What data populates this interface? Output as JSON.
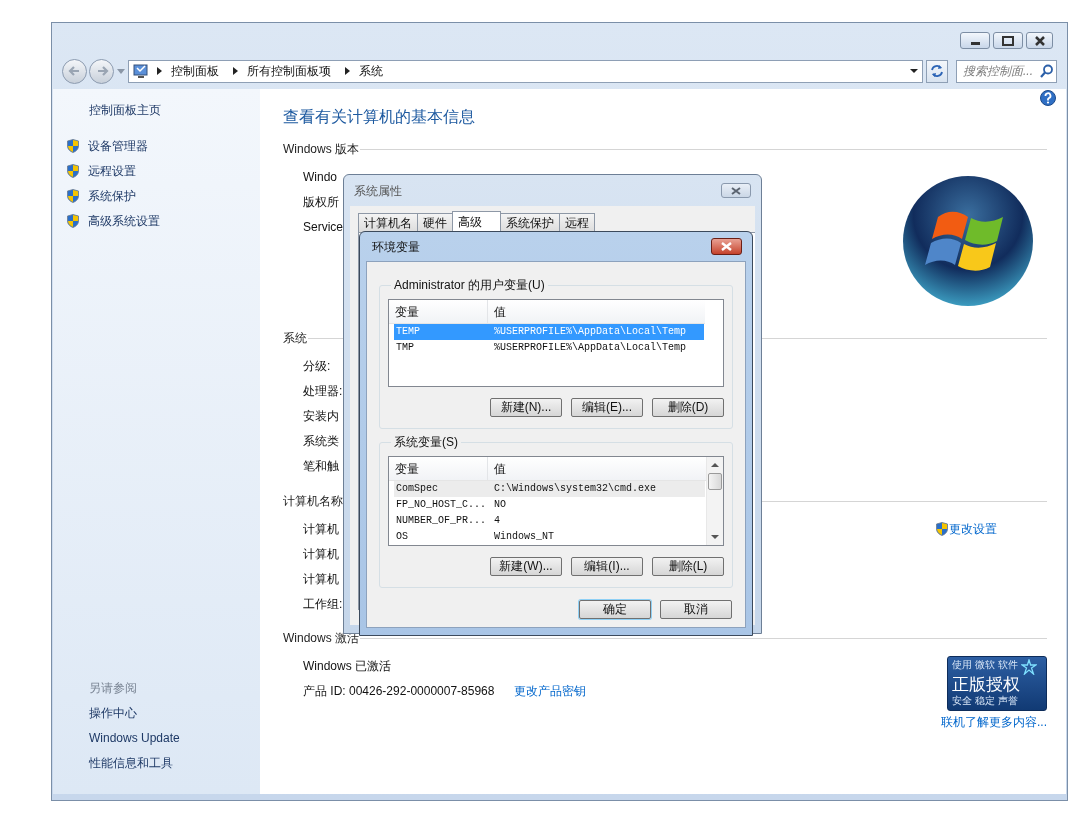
{
  "address_bar": {
    "crumbs": [
      "控制面板",
      "所有控制面板项",
      "系统"
    ],
    "search_placeholder": "搜索控制面..."
  },
  "sidebar": {
    "home": "控制面板主页",
    "tasks": [
      "设备管理器",
      "远程设置",
      "系统保护",
      "高级系统设置"
    ],
    "see_also_title": "另请参阅",
    "see_also": [
      "操作中心",
      "Windows Update",
      "性能信息和工具"
    ]
  },
  "main": {
    "title": "查看有关计算机的基本信息",
    "sections": [
      {
        "heading": "Windows 版本",
        "rows": [
          "Windo",
          "版权所",
          "Service"
        ]
      },
      {
        "heading": "系统",
        "rows": [
          "分级:",
          "处理器:",
          "安装内",
          "系统类",
          "笔和触"
        ]
      },
      {
        "heading": "计算机名称",
        "rows": [
          "计算机",
          "计算机",
          "计算机",
          "工作组:"
        ],
        "link": "更改设置"
      },
      {
        "heading": "Windows 激活",
        "rows": [
          "Windows 已激活",
          "产品 ID: 00426-292-0000007-85968"
        ],
        "link": "更改产品密钥"
      }
    ],
    "badge": {
      "top": "使用 微软 软件",
      "middle": "正版授权",
      "bottom": "安全 稳定 声誉"
    },
    "badge_link": "联机了解更多内容..."
  },
  "system_properties": {
    "title": "系统属性",
    "tabs": [
      {
        "label": "计算机名",
        "selected": false
      },
      {
        "label": "硬件",
        "selected": false
      },
      {
        "label": "高级",
        "selected": true
      },
      {
        "label": "系统保护",
        "selected": false
      },
      {
        "label": "远程",
        "selected": false
      }
    ]
  },
  "env_dialog": {
    "title": "环境变量",
    "groups": [
      {
        "title": "Administrator 的用户变量(U)",
        "focused": true,
        "columns": [
          "变量",
          "值"
        ],
        "rows": [
          {
            "name": "TEMP",
            "value": "%USERPROFILE%\\AppData\\Local\\Temp",
            "selected": true
          },
          {
            "name": "TMP",
            "value": "%USERPROFILE%\\AppData\\Local\\Temp",
            "selected": false
          }
        ],
        "buttons": [
          "新建(N)...",
          "编辑(E)...",
          "删除(D)"
        ]
      },
      {
        "title": "系统变量(S)",
        "focused": false,
        "columns": [
          "变量",
          "值"
        ],
        "rows": [
          {
            "name": "ComSpec",
            "value": "C:\\Windows\\system32\\cmd.exe",
            "selected": true
          },
          {
            "name": "FP_NO_HOST_C...",
            "value": "NO",
            "selected": false
          },
          {
            "name": "NUMBER_OF_PR...",
            "value": "4",
            "selected": false
          },
          {
            "name": "OS",
            "value": "Windows_NT",
            "selected": false
          }
        ],
        "buttons": [
          "新建(W)...",
          "编辑(I)...",
          "删除(L)"
        ]
      }
    ],
    "buttons": [
      {
        "label": "确定",
        "default": true
      },
      {
        "label": "取消",
        "default": false
      }
    ]
  }
}
